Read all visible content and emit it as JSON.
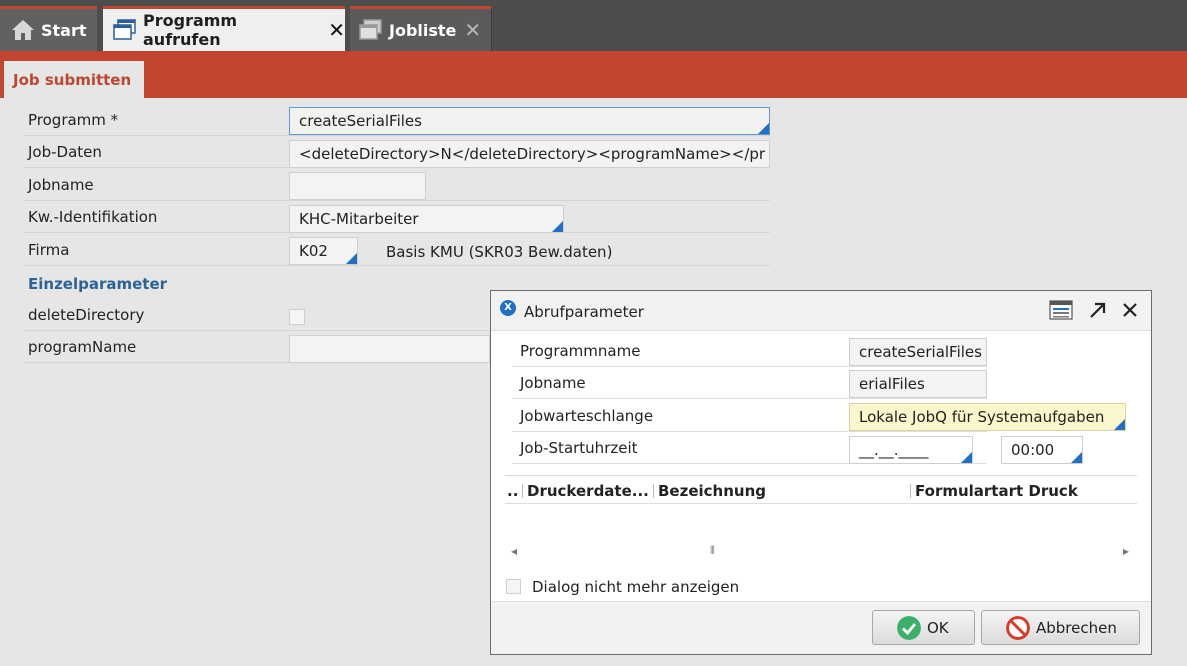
{
  "tabs": {
    "start": "Start",
    "programm": "Programm aufrufen",
    "jobliste": "Jobliste",
    "close_glyph": "✕"
  },
  "subtab": "Job submitten",
  "form": {
    "programm_label": "Programm *",
    "programm_value": "createSerialFiles",
    "jobdaten_label": "Job-Daten",
    "jobdaten_value": "<deleteDirectory>N</deleteDirectory><programName></pr",
    "jobname_label": "Jobname",
    "jobname_value": "",
    "kw_label": "Kw.-Identifikation",
    "kw_value": "KHC-Mitarbeiter",
    "firma_label": "Firma",
    "firma_value": "K02",
    "firma_desc": "Basis KMU (SKR03 Bew.daten)",
    "section": "Einzelparameter",
    "delete_label": "deleteDirectory",
    "program_label": "programName",
    "program_value": ""
  },
  "dialog": {
    "title": "Abrufparameter",
    "icon_letter": "X",
    "programmname_label": "Programmname",
    "programmname_value": "createSerialFiles",
    "jobname_label": "Jobname",
    "jobname_value": "erialFiles",
    "queue_label": "Jobwarteschlange",
    "queue_value": "Lokale JobQ für Systemaufgaben",
    "start_label": "Job-Startuhrzeit",
    "start_date": "__.__.____",
    "start_time": "00:00",
    "grid": {
      "col0": "..",
      "col1": "Druckerdate...",
      "col2": "Bezeichnung",
      "col3": "Formulartart Druck"
    },
    "scroll_left": "◂",
    "scroll_mid": "⦀",
    "scroll_right": "▸",
    "checkbox_label": "Dialog nicht mehr anzeigen",
    "ok": "OK",
    "cancel": "Abbrechen"
  },
  "colors": {
    "accent": "#c0462f",
    "topbar": "#4d4d4d",
    "link_blue": "#2a6496",
    "focus_blue": "#1f6fc5",
    "ok_green": "#3bb06a",
    "cancel_red": "#d63c2c"
  }
}
